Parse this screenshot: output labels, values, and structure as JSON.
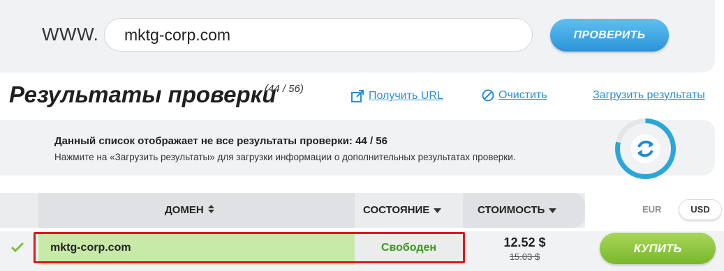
{
  "search": {
    "prefix": "WWW.",
    "domain_value": "mktg-corp.com",
    "check_button": "ПРОВЕРИТЬ"
  },
  "results": {
    "title": "Результаты проверки",
    "count": "(44 / 56)",
    "links": {
      "get_url": "Получить URL",
      "clear": "Очистить",
      "load_results": "Загрузить результаты"
    }
  },
  "notice": {
    "main": "Данный список отображает не все результаты проверки: 44 / 56",
    "sub": "Нажмите на «Загрузить результаты» для загрузки информации о дополнительных результатах проверки."
  },
  "table": {
    "columns": {
      "domain": "ДОМЕН",
      "status": "СОСТОЯНИЕ",
      "cost": "СТОИМОСТЬ"
    },
    "currencies": [
      "EUR",
      "USD"
    ],
    "selected_currency": "USD",
    "rows": [
      {
        "domain": "mktg-corp.com",
        "status": "Свободен",
        "price": "12.52 $",
        "old_price": "15.03 $",
        "buy_label": "КУПИТЬ"
      }
    ]
  },
  "progress": {
    "fraction": 0.7857
  },
  "colors": {
    "accent_blue": "#2a93d8",
    "buy_green": "#78b82a",
    "status_green": "#3c9a1c",
    "highlight_red": "#e0161e"
  }
}
